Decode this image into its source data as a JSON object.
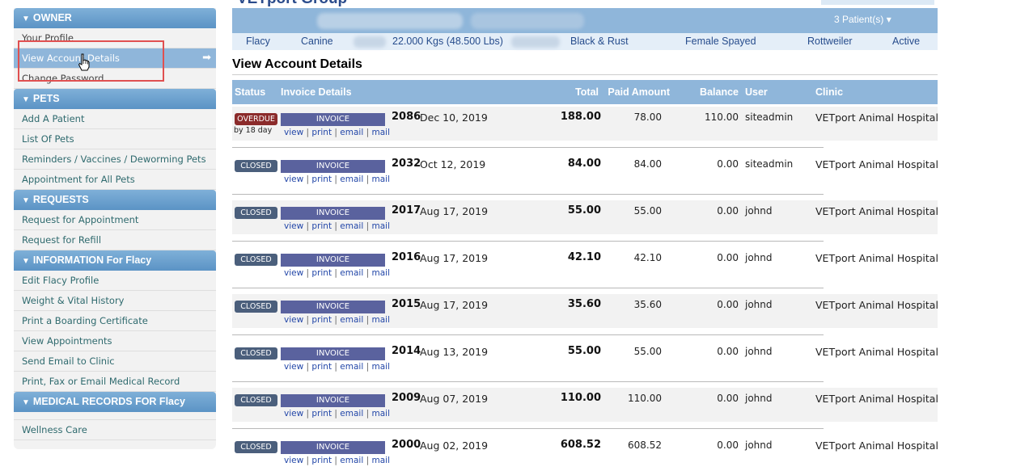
{
  "header": {
    "app_title": "VETport Group",
    "patients_link": "3 Patient(s)",
    "phone": "H:3123123123",
    "patient": {
      "name": "Flacy",
      "species": "Canine",
      "weight": "22.000 Kgs (48.500 Lbs)",
      "color": "Black & Rust",
      "sex": "Female Spayed",
      "breed": "Rottweiler",
      "status": "Active"
    }
  },
  "sidebar": {
    "sections": [
      {
        "title": "OWNER",
        "items": [
          "Your Profile",
          "View Account Details",
          "Change Password"
        ]
      },
      {
        "title": "PETS",
        "items": [
          "Add A Patient",
          "List Of Pets",
          "Reminders / Vaccines / Deworming Pets",
          "Appointment for All Pets"
        ]
      },
      {
        "title": "REQUESTS",
        "items": [
          "Request for Appointment",
          "Request for Refill"
        ]
      },
      {
        "title": "INFORMATION For Flacy",
        "items": [
          "Edit Flacy Profile",
          "Weight & Vital History",
          "Print a Boarding Certificate",
          "View Appointments",
          "Send Email to Clinic",
          "Print, Fax or Email Medical Record"
        ]
      },
      {
        "title": "MEDICAL RECORDS FOR Flacy",
        "items": [
          "Wellness Care"
        ]
      }
    ],
    "active_item": "View Account Details"
  },
  "main": {
    "title": "View Account Details",
    "columns": [
      "Status",
      "Invoice Details",
      "Total",
      "Paid Amount",
      "Balance",
      "User",
      "Clinic"
    ],
    "invoice_button": "INVOICE",
    "links": [
      "view",
      "print",
      "email",
      "mail"
    ],
    "rows": [
      {
        "status": "OVERDUE",
        "overdue_note": "by 18 day",
        "number": "2086",
        "date": "Dec 10, 2019",
        "total": "188.00",
        "paid": "78.00",
        "balance": "110.00",
        "user": "siteadmin",
        "clinic": "VETport Animal Hospital"
      },
      {
        "status": "CLOSED",
        "number": "2032",
        "date": "Oct 12, 2019",
        "total": "84.00",
        "paid": "84.00",
        "balance": "0.00",
        "user": "siteadmin",
        "clinic": "VETport Animal Hospital"
      },
      {
        "status": "CLOSED",
        "number": "2017",
        "date": "Aug 17, 2019",
        "total": "55.00",
        "paid": "55.00",
        "balance": "0.00",
        "user": "johnd",
        "clinic": "VETport Animal Hospital"
      },
      {
        "status": "CLOSED",
        "number": "2016",
        "date": "Aug 17, 2019",
        "total": "42.10",
        "paid": "42.10",
        "balance": "0.00",
        "user": "johnd",
        "clinic": "VETport Animal Hospital"
      },
      {
        "status": "CLOSED",
        "number": "2015",
        "date": "Aug 17, 2019",
        "total": "35.60",
        "paid": "35.60",
        "balance": "0.00",
        "user": "johnd",
        "clinic": "VETport Animal Hospital"
      },
      {
        "status": "CLOSED",
        "number": "2014",
        "date": "Aug 13, 2019",
        "total": "55.00",
        "paid": "55.00",
        "balance": "0.00",
        "user": "johnd",
        "clinic": "VETport Animal Hospital"
      },
      {
        "status": "CLOSED",
        "number": "2009",
        "date": "Aug 07, 2019",
        "total": "110.00",
        "paid": "110.00",
        "balance": "0.00",
        "user": "johnd",
        "clinic": "VETport Animal Hospital"
      },
      {
        "status": "CLOSED",
        "number": "2000",
        "date": "Aug 02, 2019",
        "total": "608.52",
        "paid": "608.52",
        "balance": "0.00",
        "user": "johnd",
        "clinic": "VETport Animal Hospital"
      }
    ]
  },
  "colors": {
    "header_blue": "#8fb6da",
    "section_blue": "#5b93c5",
    "overdue_red": "#8b2b2b",
    "closed_slate": "#4b5f7c",
    "invoice_button": "#5a629e",
    "highlight_box": "#e05050"
  },
  "icons": {
    "menu_arrow": "arrow-right-icon",
    "section_toggle": "triangle-down-icon",
    "cursor": "hand-pointer-icon"
  }
}
